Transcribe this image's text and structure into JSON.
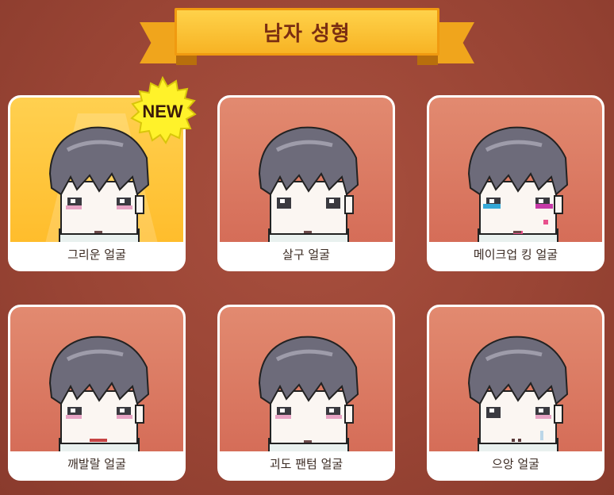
{
  "header": {
    "title": "남자 성형"
  },
  "badge": {
    "text": "NEW"
  },
  "cards": [
    {
      "label": "그리운 얼굴",
      "selected": true,
      "variant": "pink-cheek"
    },
    {
      "label": "살구 얼굴",
      "selected": false,
      "variant": "plain"
    },
    {
      "label": "메이크업 킹 얼굴",
      "selected": false,
      "variant": "makeup"
    },
    {
      "label": "깨발랄 얼굴",
      "selected": false,
      "variant": "cheerful"
    },
    {
      "label": "괴도 팬텀 얼굴",
      "selected": false,
      "variant": "phantom"
    },
    {
      "label": "으앙 얼굴",
      "selected": false,
      "variant": "cry"
    }
  ],
  "colors": {
    "card_bg": "#e28a70",
    "selected_bg": "#ffc53a",
    "ribbon": "#f7b324",
    "title": "#7a2e12"
  }
}
